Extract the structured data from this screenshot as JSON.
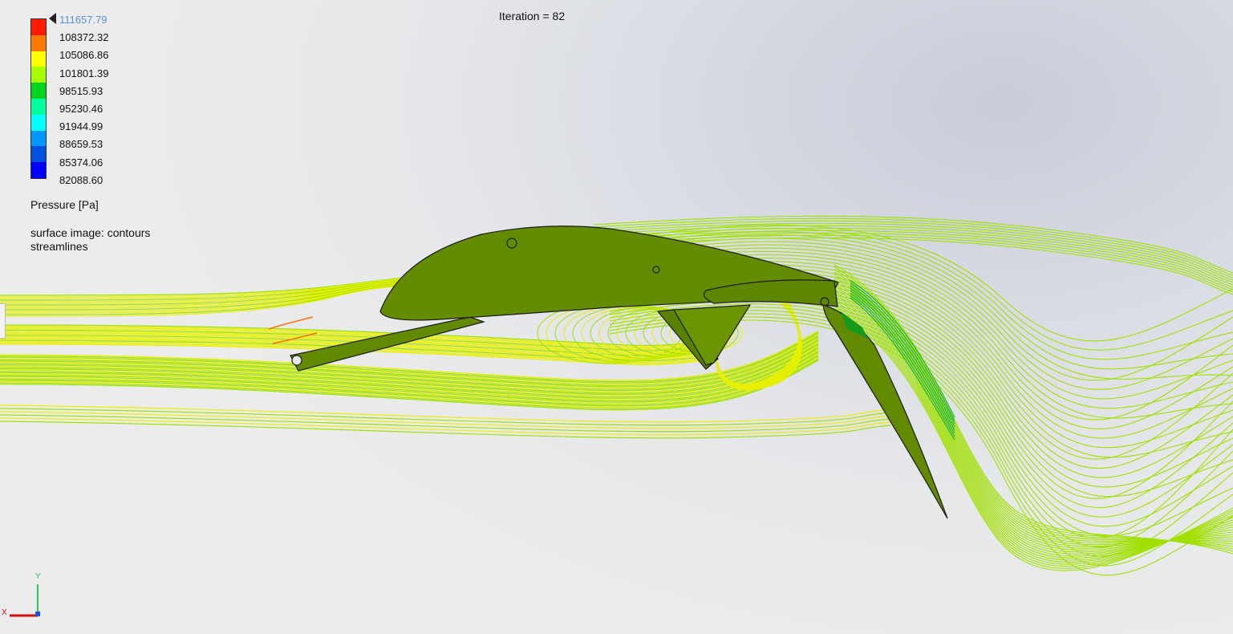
{
  "header": {
    "iteration_label": "Iteration = 82"
  },
  "legend": {
    "ticks": [
      "111657.79",
      "108372.32",
      "105086.86",
      "101801.39",
      "98515.93",
      "95230.46",
      "91944.99",
      "88659.53",
      "85374.06",
      "82088.60"
    ],
    "colors": [
      "#ff1a00",
      "#ff7a00",
      "#ffff00",
      "#a6ff00",
      "#00d21e",
      "#00ffa0",
      "#00ffff",
      "#0096ff",
      "#0050e0",
      "#0000ff"
    ],
    "title": "Pressure [Pa]",
    "info_line1": "surface image: contours",
    "info_line2": "streamlines",
    "max_color": "#5a8fd0"
  },
  "triad": {
    "x_label": "X",
    "y_label": "Y"
  },
  "scene_colors": {
    "body": "#638c00",
    "streamline_green": "#a0e000",
    "streamline_yellow": "#e8f000"
  }
}
